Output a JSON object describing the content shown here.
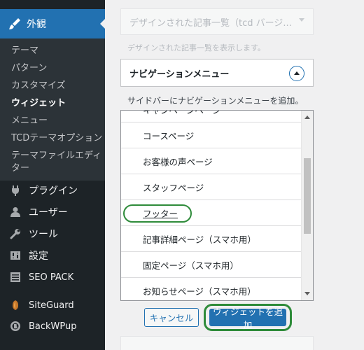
{
  "sidebar": {
    "active": {
      "label": "外観",
      "icon": "paintbrush-icon"
    },
    "submenu": [
      {
        "label": "テーマ"
      },
      {
        "label": "パターン"
      },
      {
        "label": "カスタマイズ"
      },
      {
        "label": "ウィジェット",
        "current": true
      },
      {
        "label": "メニュー"
      },
      {
        "label": "TCDテーマオプション"
      },
      {
        "label": "テーマファイルエディ"
      },
      {
        "label": "ター"
      }
    ],
    "menu": [
      {
        "label": "プラグイン",
        "icon": "plugin-icon"
      },
      {
        "label": "ユーザー",
        "icon": "user-icon"
      },
      {
        "label": "ツール",
        "icon": "wrench-icon"
      },
      {
        "label": "設定",
        "icon": "settings-icon"
      },
      {
        "label": "SEO PACK",
        "icon": "list-icon"
      },
      {
        "label": "SiteGuard",
        "icon": "siteguard-icon"
      },
      {
        "label": "BackWPup",
        "icon": "backwpup-icon"
      }
    ]
  },
  "widgets": {
    "ghost": {
      "title": "デザインされた記事一覧（tcd バージ...",
      "description": "デザインされた記事一覧を表示します。"
    },
    "nav_menu": {
      "title": "ナビゲーションメニュー",
      "description": "サイドバーにナビゲーションメニューを追加。"
    }
  },
  "list": {
    "items": [
      {
        "label": "キャンペーンページ"
      },
      {
        "label": "コースページ"
      },
      {
        "label": "お客様の声ページ"
      },
      {
        "label": "スタッフページ"
      },
      {
        "label": "フッター",
        "highlighted": true
      },
      {
        "label": "記事詳細ページ（スマホ用）"
      },
      {
        "label": "固定ページ（スマホ用）"
      },
      {
        "label": "お知らせページ（スマホ用）"
      }
    ]
  },
  "buttons": {
    "cancel": "キャンセル",
    "add": "ウィジェットを追加"
  },
  "colors": {
    "sidebar_bg": "#1d2327",
    "submenu_bg": "#2c3338",
    "accent": "#2271b1",
    "highlight": "#2e8b3a"
  }
}
